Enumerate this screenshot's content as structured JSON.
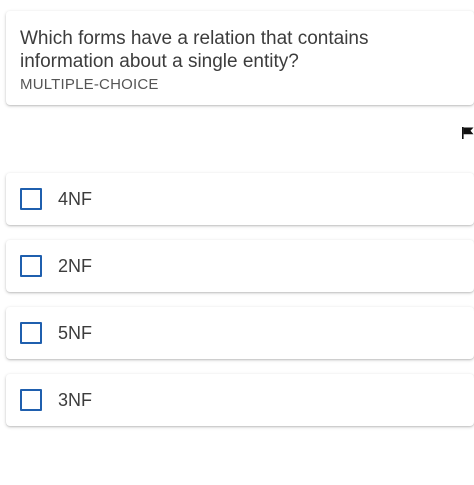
{
  "question": {
    "text": "Which forms have a relation that contains information about a single entity?",
    "type": "MULTIPLE-CHOICE"
  },
  "flag_icon": "flag-icon",
  "options": [
    {
      "label": "4NF",
      "checked": false
    },
    {
      "label": "2NF",
      "checked": false
    },
    {
      "label": "5NF",
      "checked": false
    },
    {
      "label": "3NF",
      "checked": false
    }
  ],
  "colors": {
    "checkbox_border": "#1f5fae",
    "text": "#3c3c3c"
  }
}
